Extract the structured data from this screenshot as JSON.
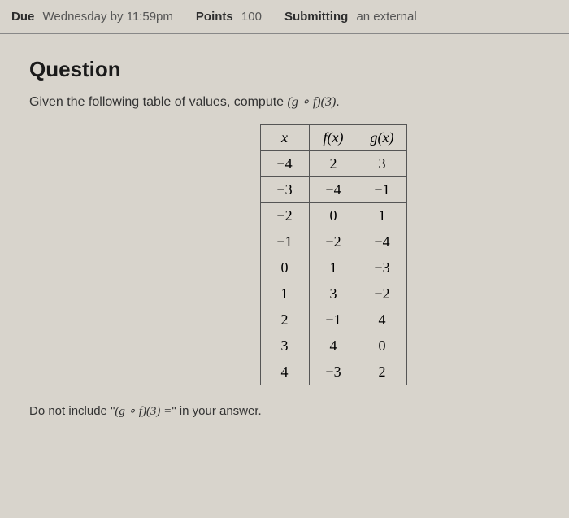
{
  "meta": {
    "due_label": "Due",
    "due_value": "Wednesday by 11:59pm",
    "points_label": "Points",
    "points_value": "100",
    "submitting_label": "Submitting",
    "submitting_value": "an external"
  },
  "question": {
    "title": "Question",
    "prompt_prefix": "Given the following table of values, compute ",
    "prompt_expr": "(g ∘ f)(3)",
    "prompt_suffix": "."
  },
  "chart_data": {
    "type": "table",
    "columns": [
      "x",
      "f(x)",
      "g(x)"
    ],
    "rows": [
      {
        "x": "−4",
        "fx": "2",
        "gx": "3"
      },
      {
        "x": "−3",
        "fx": "−4",
        "gx": "−1"
      },
      {
        "x": "−2",
        "fx": "0",
        "gx": "1"
      },
      {
        "x": "−1",
        "fx": "−2",
        "gx": "−4"
      },
      {
        "x": "0",
        "fx": "1",
        "gx": "−3"
      },
      {
        "x": "1",
        "fx": "3",
        "gx": "−2"
      },
      {
        "x": "2",
        "fx": "−1",
        "gx": "4"
      },
      {
        "x": "3",
        "fx": "4",
        "gx": "0"
      },
      {
        "x": "4",
        "fx": "−3",
        "gx": "2"
      }
    ]
  },
  "footer": {
    "prefix": "Do not include \"",
    "expr": "(g ∘ f)(3) =",
    "suffix": "\" in your answer."
  }
}
